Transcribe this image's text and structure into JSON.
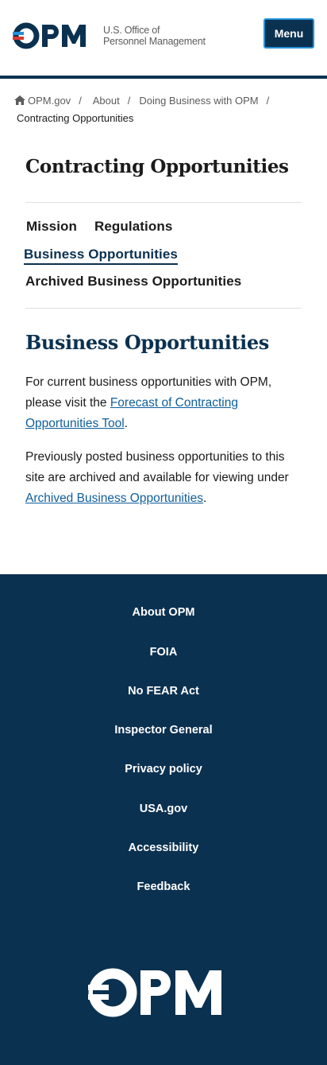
{
  "header": {
    "logo_letters": "OPM",
    "logo_line1": "U.S. Office of",
    "logo_line2": "Personnel Management",
    "menu_label": "Menu"
  },
  "breadcrumb": {
    "items": [
      "OPM.gov",
      "About",
      "Doing Business with OPM"
    ],
    "separator": "/",
    "current": "Contracting Opportunities"
  },
  "main": {
    "page_title": "Contracting Opportunities",
    "subnav": [
      "Mission",
      "Regulations",
      "Business Opportunities",
      "Archived Business Opportunities"
    ],
    "active_subnav": "Business Opportunities",
    "section_title": "Business Opportunities",
    "para1_before": "For current business opportunities with OPM, please visit the ",
    "para1_link": "Forecast of Contracting Opportunities Tool",
    "para1_after": ".",
    "para2_before": "Previously posted business opportunities to this site are archived and available for viewing under ",
    "para2_link": "Archived Business Opportunities",
    "para2_after": "."
  },
  "footer": {
    "links": [
      "About OPM",
      "FOIA",
      "No FEAR Act",
      "Inspector General",
      "Privacy policy",
      "USA.gov",
      "Accessibility",
      "Feedback"
    ],
    "logo_letters": "OPM"
  },
  "colors": {
    "navy": "#0b3150",
    "link_blue": "#0f5f9c",
    "accent_red": "#d83933",
    "accent_blue": "#2491d6"
  },
  "icons": [
    "home-icon",
    "opm-logo-icon"
  ]
}
